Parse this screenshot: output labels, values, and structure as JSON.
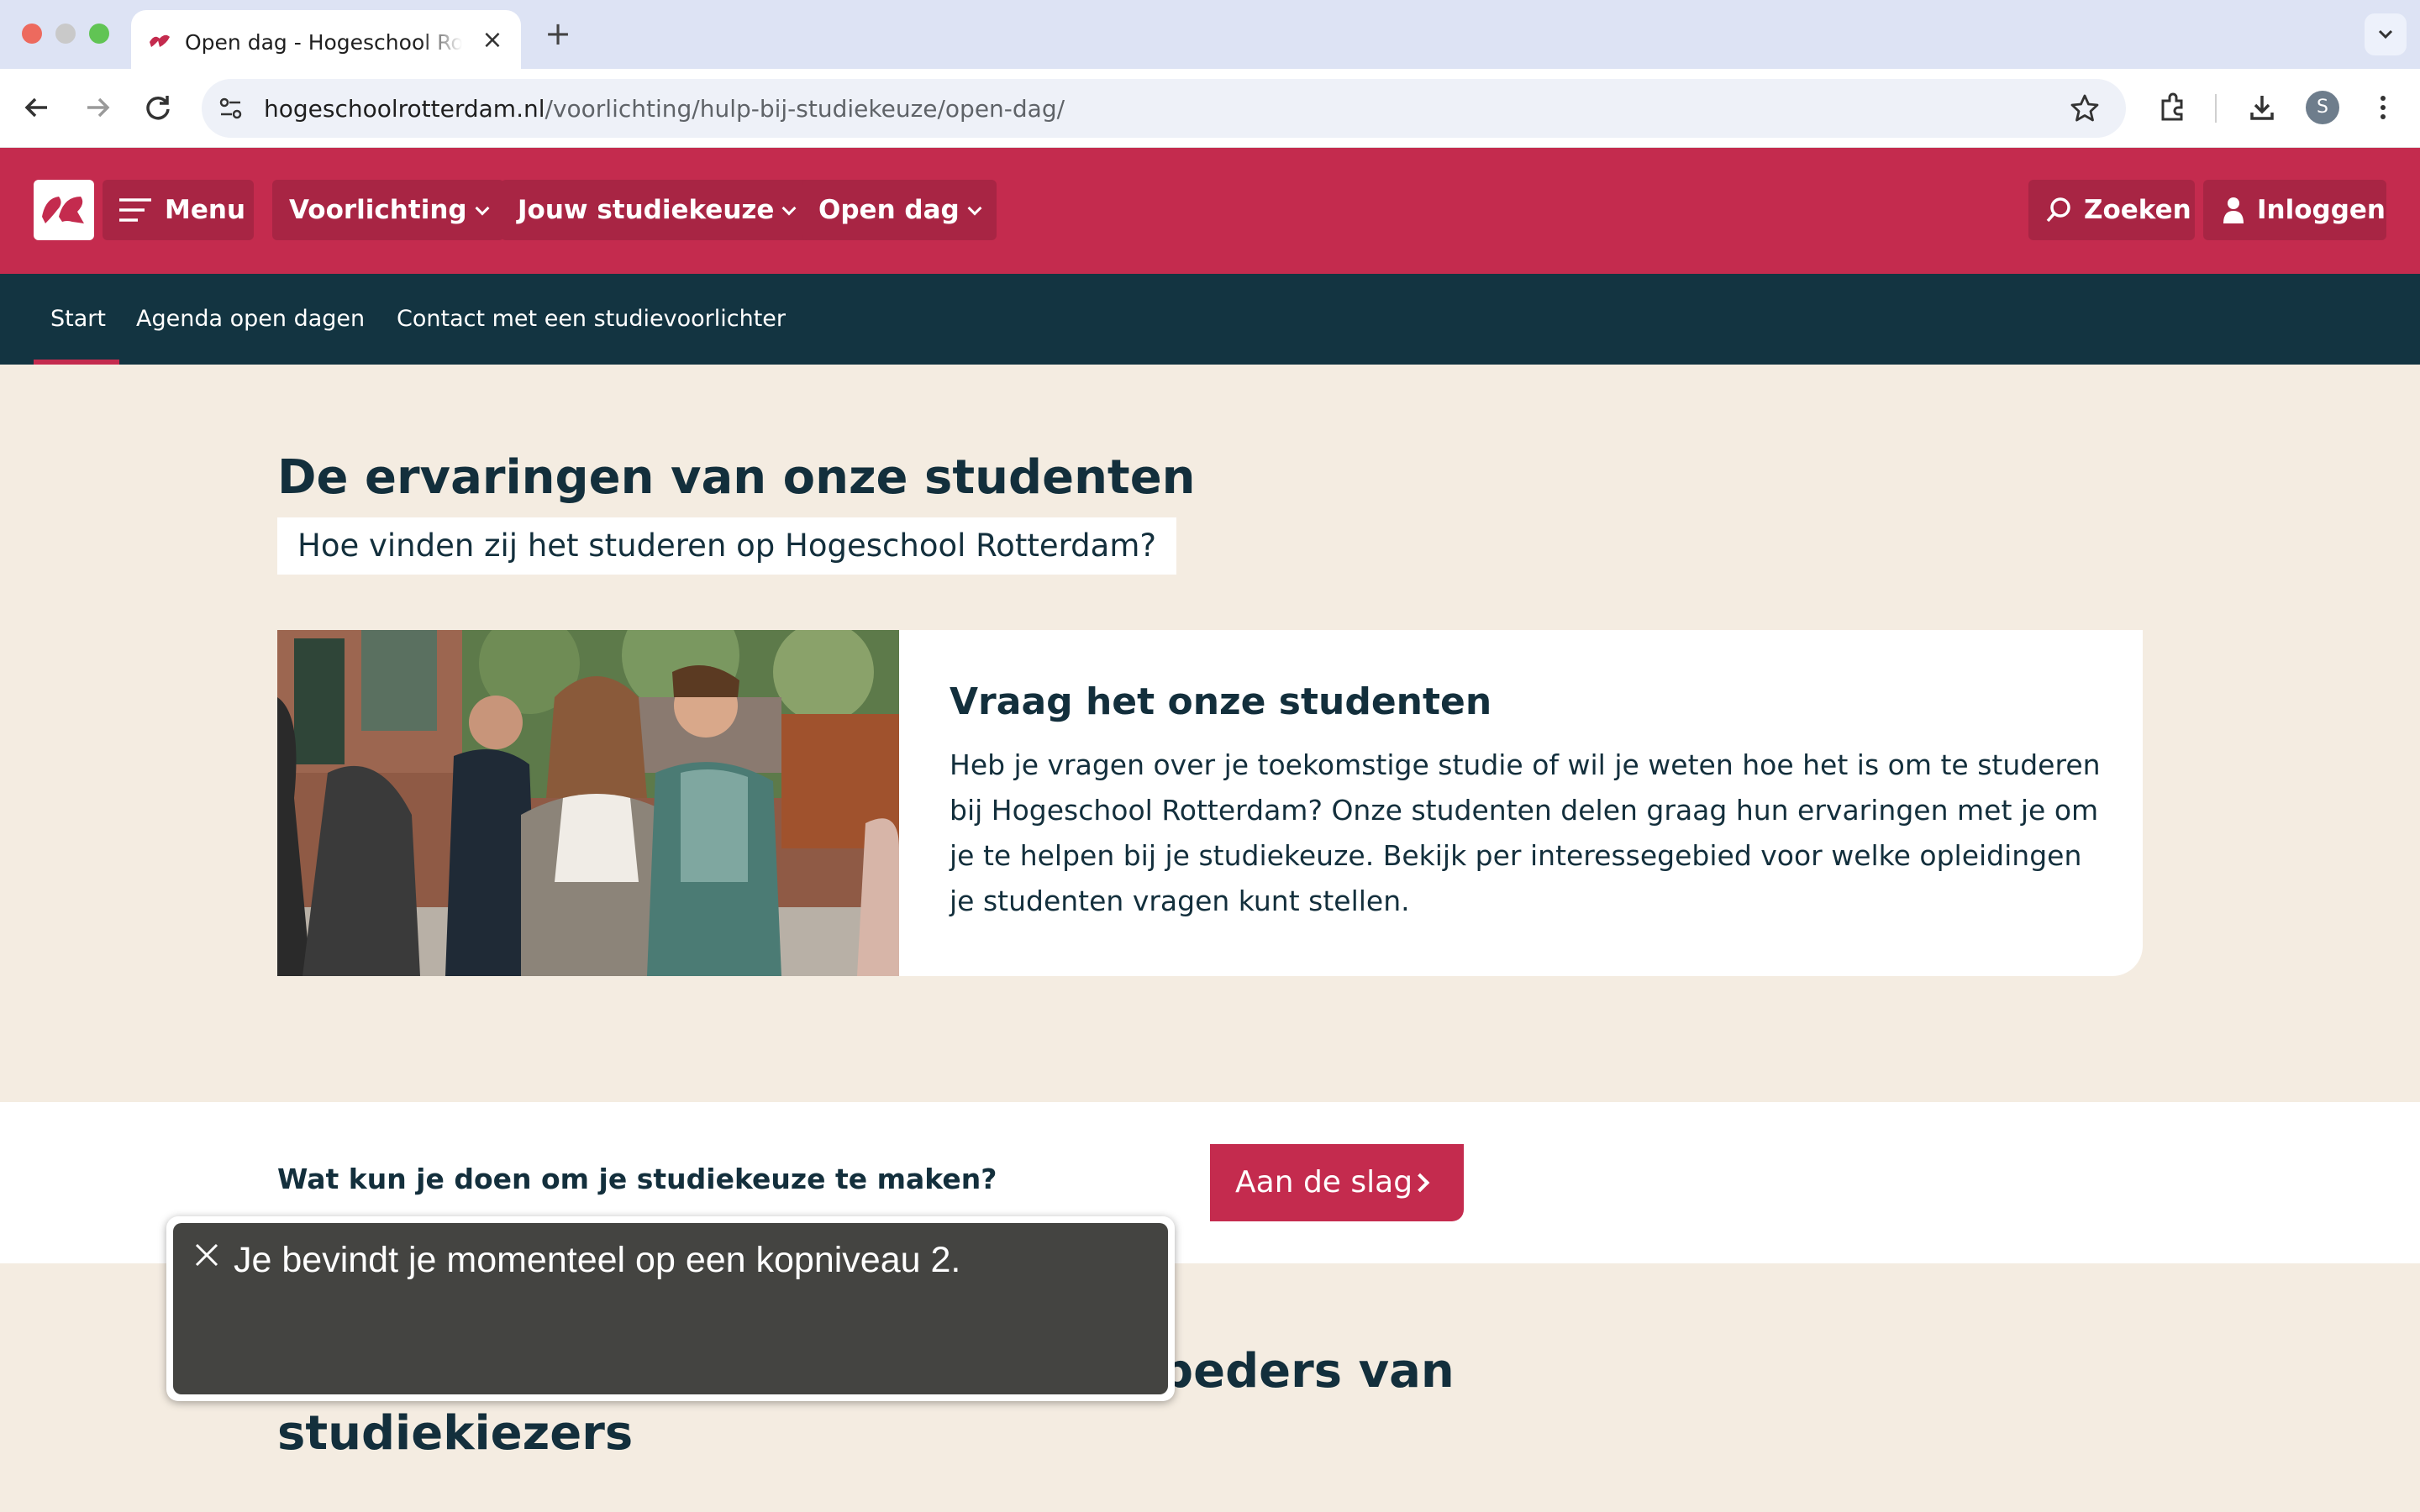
{
  "browser": {
    "tab_title": "Open dag - Hogeschool Rotterdam",
    "url_host": "hogeschoolrotterdam.nl",
    "url_path": "/voorlichting/hulp-bij-studiekeuze/open-dag/",
    "profile_initial": "S"
  },
  "header": {
    "menu_label": "Menu",
    "nav": [
      {
        "label": "Voorlichting"
      },
      {
        "label": "Jouw studiekeuze"
      },
      {
        "label": "Open dag"
      }
    ],
    "search_label": "Zoeken",
    "login_label": "Inloggen"
  },
  "subnav": {
    "items": [
      {
        "label": "Start"
      },
      {
        "label": "Agenda open dagen"
      },
      {
        "label": "Contact met een studievoorlichter"
      }
    ]
  },
  "experiences": {
    "title": "De ervaringen van onze studenten",
    "subtitle": "Hoe vinden zij het studeren op Hogeschool Rotterdam?",
    "card_title": "Vraag het onze studenten",
    "card_text": "Heb je vragen over je toekomstige studie of wil je weten hoe het is om te studeren bij Hogeschool Rotterdam? Onze studenten delen graag hun ervaringen met je om je te helpen bij je studiekeuze. Bekijk per interessegebied voor welke opleidingen je studenten vragen kunt stellen."
  },
  "cta": {
    "question": "Wat kun je doen om je studiekeuze te maken?",
    "button_label": "Aan de slag"
  },
  "bottom": {
    "title_visible": "beders van studiekiezers"
  },
  "voiceover": {
    "caption": "Je bevindt je momenteel op een kopniveau 2."
  },
  "colors": {
    "brand_red": "#c42b4e",
    "navy": "#133441",
    "background": "#f4ece1"
  }
}
